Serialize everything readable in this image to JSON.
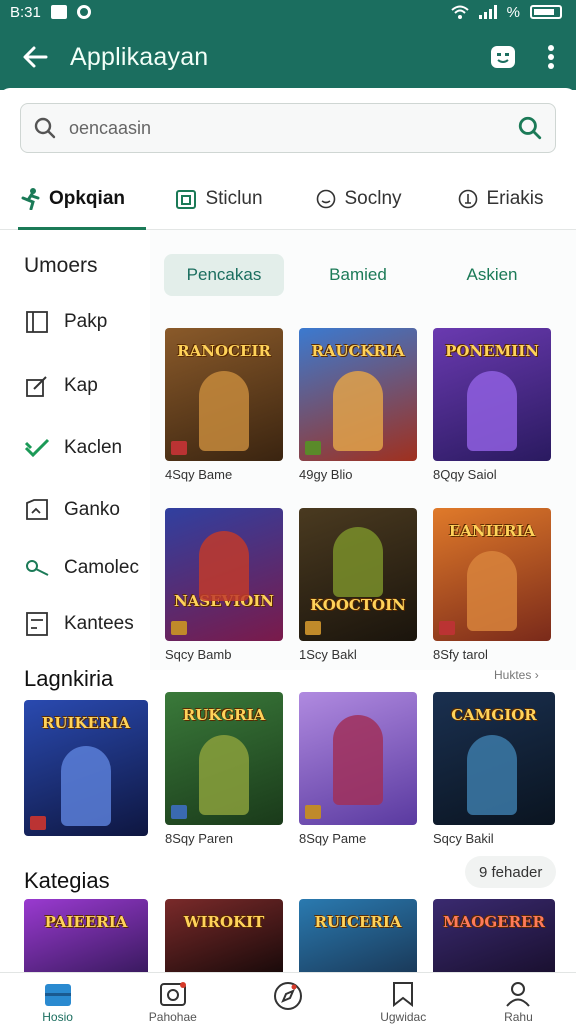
{
  "status_bar": {
    "time": "B:31",
    "signal": "%"
  },
  "app_bar": {
    "title": "Applikaayan"
  },
  "search": {
    "placeholder": "oencaasin"
  },
  "tabs": [
    {
      "label": "Opkqian",
      "icon": "run-icon",
      "active": true
    },
    {
      "label": "Sticlun",
      "icon": "calendar-icon",
      "active": false
    },
    {
      "label": "Soclny",
      "icon": "smile-icon",
      "active": false
    },
    {
      "label": "Eriakis",
      "icon": "info-icon",
      "active": false
    }
  ],
  "sidebar": {
    "heading": "Umoers",
    "items": [
      {
        "label": "Pakp",
        "icon": "book-icon"
      },
      {
        "label": "Kap",
        "icon": "edit-icon"
      },
      {
        "label": "Kaclen",
        "icon": "check-icon"
      },
      {
        "label": "Ganko",
        "icon": "folder-icon"
      },
      {
        "label": "Camolec",
        "icon": "key-icon"
      },
      {
        "label": "Kantees",
        "icon": "document-icon"
      }
    ]
  },
  "chips": [
    {
      "label": "Pencakas",
      "active": true
    },
    {
      "label": "Bamied",
      "active": false
    },
    {
      "label": "Askien",
      "active": false
    }
  ],
  "grid_row1": [
    {
      "title": "RANOCEIR",
      "label": "4Sqy Bame",
      "bg": "#6b3f1c",
      "fig": "#c58a3c"
    },
    {
      "title": "RAUCKRIA",
      "label": "49gy Blio",
      "bg": "#2c5fa8",
      "fig": "#e0a24a"
    },
    {
      "title": "PONEMIIN",
      "label": "8Qqy Saiol",
      "bg": "#4a2a8a",
      "fig": "#8f5fe0"
    }
  ],
  "grid_row2": [
    {
      "title": "NASEVIOIN",
      "label": "Sqcy Bamb",
      "bg": "#5b1a55",
      "fig": "#c0392b"
    },
    {
      "title": "KOOCTOIN",
      "label": "1Scy Bakl",
      "bg": "#2b2218",
      "fig": "#7a8f2a"
    },
    {
      "title": "EANIERIA",
      "label": "8Sfy tarol",
      "bg": "#b5521e",
      "fig": "#d8843c"
    }
  ],
  "more_link": "Huktes",
  "featured": {
    "heading": "Lagnkiria",
    "card": {
      "title": "RUIKERIA",
      "bg": "#1a2c6b",
      "fig": "#5a7fd8"
    },
    "items": [
      {
        "title": "RUKGRIA",
        "label": "8Sqy Paren",
        "bg": "#2d5a2a",
        "fig": "#8aa03c"
      },
      {
        "title": "",
        "label": "8Sqy Pame",
        "bg": "#7a4fc0",
        "fig": "#a0305a"
      },
      {
        "title": "CAMGIOR",
        "label": "Sqcy Bakil",
        "bg": "#16304a",
        "fig": "#3c7aa8"
      }
    ]
  },
  "categories": {
    "heading": "Kategias",
    "pill": "9 fehader",
    "items": [
      {
        "title": "PAIEERIA",
        "bg": "#6a2a9a"
      },
      {
        "title": "WIROKIT",
        "bg": "#5a1a1a"
      },
      {
        "title": "RUICERIA",
        "bg": "#1a4a7a"
      },
      {
        "title": "MAOGERER",
        "bg": "#2a2050"
      }
    ]
  },
  "bottom_nav": [
    {
      "label": "Hosio",
      "icon": "home-icon",
      "active": true
    },
    {
      "label": "Pahohae",
      "icon": "camera-icon",
      "active": false
    },
    {
      "label": "",
      "icon": "compass-icon",
      "active": false
    },
    {
      "label": "Ugwidac",
      "icon": "bookmark-icon",
      "active": false
    },
    {
      "label": "Rahu",
      "icon": "person-icon",
      "active": false
    }
  ],
  "colors": {
    "primary": "#1b6e5f",
    "accent": "#1b7a57"
  }
}
